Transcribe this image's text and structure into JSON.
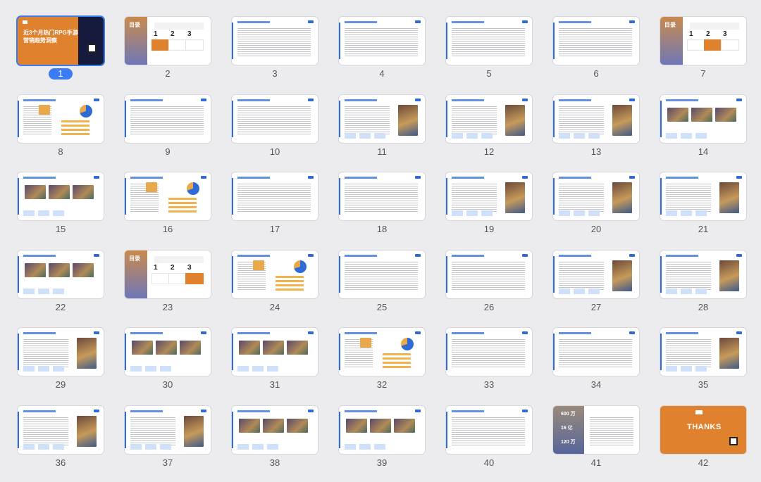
{
  "selected_slide": "1",
  "slides": [
    {
      "number": "1",
      "layout": "cover",
      "title_line1": "近3个月热门RPG手游",
      "title_line2": "营销趋势洞察"
    },
    {
      "number": "2",
      "layout": "toc",
      "heading": "目录",
      "active": 1,
      "toc_numbers": [
        "1",
        "2",
        "3"
      ]
    },
    {
      "number": "3",
      "layout": "table"
    },
    {
      "number": "4",
      "layout": "table"
    },
    {
      "number": "5",
      "layout": "table"
    },
    {
      "number": "6",
      "layout": "table"
    },
    {
      "number": "7",
      "layout": "toc",
      "heading": "目录",
      "active": 2,
      "toc_numbers": [
        "1",
        "2",
        "3"
      ]
    },
    {
      "number": "8",
      "layout": "chart"
    },
    {
      "number": "9",
      "layout": "text"
    },
    {
      "number": "10",
      "layout": "text"
    },
    {
      "number": "11",
      "layout": "text-image"
    },
    {
      "number": "12",
      "layout": "text-image"
    },
    {
      "number": "13",
      "layout": "text-image"
    },
    {
      "number": "14",
      "layout": "images"
    },
    {
      "number": "15",
      "layout": "images"
    },
    {
      "number": "16",
      "layout": "chart"
    },
    {
      "number": "17",
      "layout": "text"
    },
    {
      "number": "18",
      "layout": "text"
    },
    {
      "number": "19",
      "layout": "text-image"
    },
    {
      "number": "20",
      "layout": "text-image"
    },
    {
      "number": "21",
      "layout": "text-image"
    },
    {
      "number": "22",
      "layout": "images"
    },
    {
      "number": "23",
      "layout": "toc",
      "heading": "目录",
      "active": 3,
      "toc_numbers": [
        "1",
        "2",
        "3"
      ]
    },
    {
      "number": "24",
      "layout": "chart"
    },
    {
      "number": "25",
      "layout": "text"
    },
    {
      "number": "26",
      "layout": "text"
    },
    {
      "number": "27",
      "layout": "text-image"
    },
    {
      "number": "28",
      "layout": "text-image"
    },
    {
      "number": "29",
      "layout": "text-image"
    },
    {
      "number": "30",
      "layout": "images"
    },
    {
      "number": "31",
      "layout": "images"
    },
    {
      "number": "32",
      "layout": "chart"
    },
    {
      "number": "33",
      "layout": "text"
    },
    {
      "number": "34",
      "layout": "text"
    },
    {
      "number": "35",
      "layout": "text-image"
    },
    {
      "number": "36",
      "layout": "text-image"
    },
    {
      "number": "37",
      "layout": "text-image"
    },
    {
      "number": "38",
      "layout": "images"
    },
    {
      "number": "39",
      "layout": "images"
    },
    {
      "number": "40",
      "layout": "plain"
    },
    {
      "number": "41",
      "layout": "stats",
      "stats": [
        "600 万",
        "16 亿",
        "120 万"
      ]
    },
    {
      "number": "42",
      "layout": "thanks",
      "title": "THANKS"
    }
  ],
  "colors": {
    "accent": "#3b7cf6",
    "brand_orange": "#e0812e",
    "navy": "#161a3c",
    "slide_blue": "#2f6bd6"
  }
}
